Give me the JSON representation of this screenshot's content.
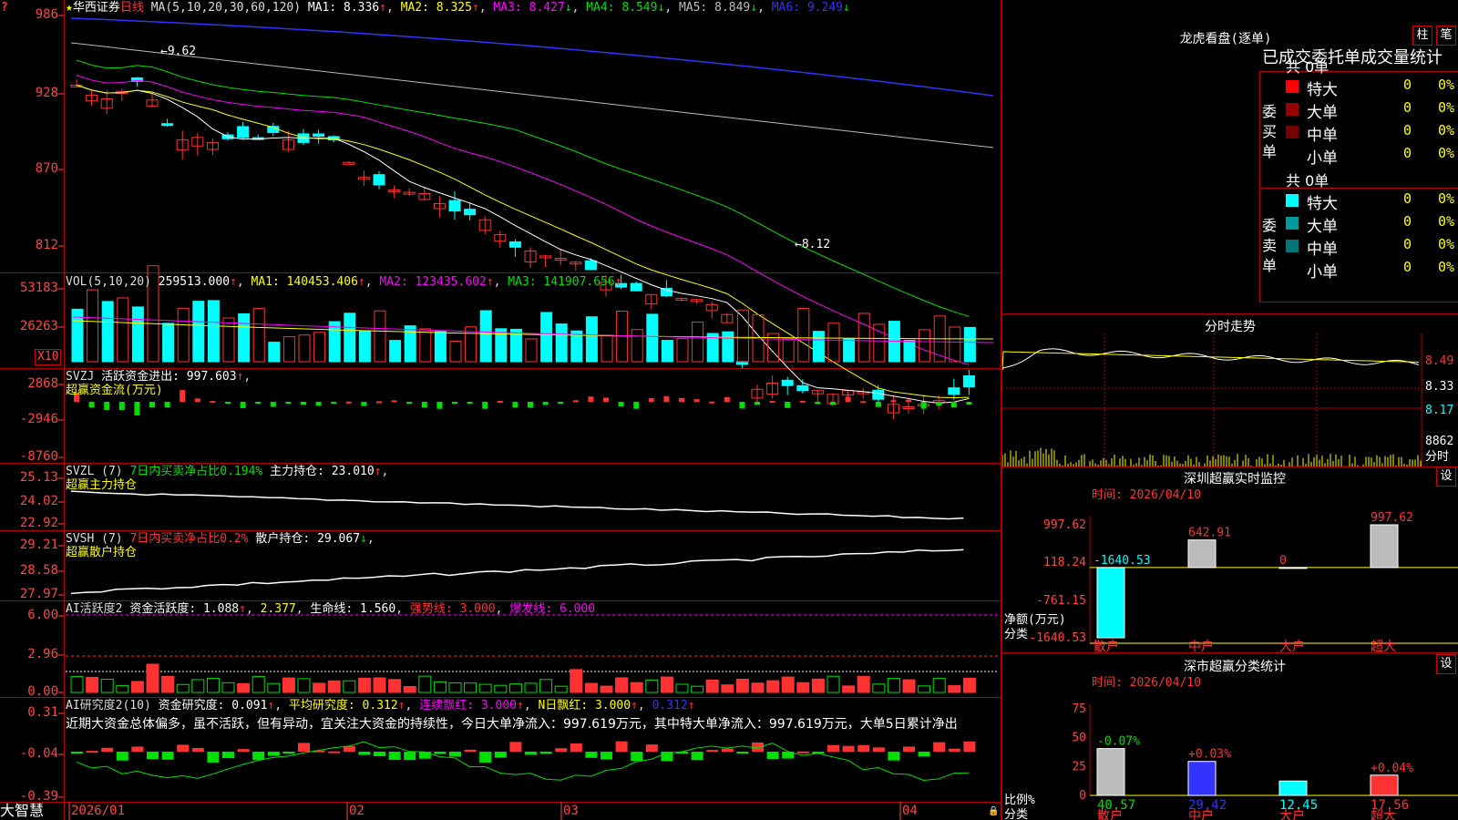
{
  "colors": {
    "up": "#ff3232",
    "down": "#00ffff",
    "green": "#00e000",
    "frame": "#b00000",
    "axis": "#ff4444",
    "white": "#ffffff",
    "yellow": "#ffff00",
    "magenta": "#ff00ff",
    "blue": "#3333ff",
    "gray": "#bbbbbb"
  },
  "corner_glyph": "?",
  "kline": {
    "star": "★",
    "name": "华西证券",
    "period": "日线",
    "ma_set": "MA(5,10,20,30,60,120)",
    "ma": [
      {
        "label": "MA1: 8.336",
        "arrow": "↑",
        "color": "#ffffff"
      },
      {
        "label": "MA2: 8.325",
        "arrow": "↑",
        "color": "#ffff00"
      },
      {
        "label": "MA3: 8.427",
        "arrow": "↓",
        "color": "#ff00ff"
      },
      {
        "label": "MA4: 8.549",
        "arrow": "↓",
        "color": "#00e000"
      },
      {
        "label": "MA5: 8.849",
        "arrow": "↓",
        "color": "#bbbbbb"
      },
      {
        "label": "MA6: 9.249",
        "arrow": "↓",
        "color": "#3333ff"
      }
    ],
    "yticks": [
      "986",
      "928",
      "870",
      "812"
    ],
    "high_note": "9.62",
    "low_note": "8.12"
  },
  "vol": {
    "title": "VOL(5,10,20)",
    "value": "259513.000",
    "ma1": "MA1: 140453.406",
    "ma2": "MA2: 123435.602",
    "ma3": "MA3: 141907.656",
    "yticks": [
      "53183",
      "26263"
    ],
    "unit": "X10"
  },
  "svzj": {
    "title": "SVZJ",
    "label": "活跃资金进出: 997.603",
    "sub": "超赢资金流(万元)",
    "yticks": [
      "2868",
      "-2946",
      "-8760"
    ]
  },
  "svzl": {
    "title": "SVZL (7)",
    "desc": "7日内买卖净占比0.194%",
    "label": "主力持仓: 23.010",
    "sub": "超赢主力持仓",
    "yticks": [
      "25.13",
      "24.02",
      "22.92"
    ]
  },
  "svsh": {
    "title": "SVSH (7)",
    "desc": "7日内买卖净占比0.2%",
    "label": "散户持仓: 29.067",
    "sub": "超赢散户持仓",
    "yticks": [
      "29.21",
      "28.58",
      "27.97"
    ]
  },
  "ai1": {
    "title": "AI活跃度2",
    "l1": "资金活跃度: 1.088",
    "l2": "2.377",
    "l3": "生命线: 1.560",
    "l4": "强势线: 3.000",
    "l5": "爆发线: 6.000",
    "yticks": [
      "6.00",
      "2.96",
      "0.00"
    ]
  },
  "ai2": {
    "title": "AI研究度2(10)",
    "l1": "资金研究度: 0.091",
    "l2": "平均研究度: 0.312",
    "l3": "连续飘红: 3.000",
    "l4": "N日飘红: 3.000",
    "l5": "0.312",
    "comment": "近期大资金总体偏多，虽不活跃，但有异动，宜关注大资金的持续性，今日大单净流入：997.619万元，其中特大单净流入：997.619万元，大单5日累计净出",
    "yticks": [
      "0.31",
      "-0.04",
      "-0.39"
    ]
  },
  "xaxis": {
    "labels": [
      "2026/01",
      "02",
      "03",
      "04"
    ]
  },
  "brand": "大智慧",
  "longhu": {
    "title": "龙虎看盘(逐单)",
    "btn1": "柱",
    "btn2": "笔",
    "header": "已成交委托单成交量统计",
    "buy": {
      "side": "委买单",
      "total": "共 0单",
      "rows": [
        {
          "name": "特大",
          "count": "0",
          "pct": "0%"
        },
        {
          "name": "大单",
          "count": "0",
          "pct": "0%"
        },
        {
          "name": "中单",
          "count": "0",
          "pct": "0%"
        },
        {
          "name": "小单",
          "count": "0",
          "pct": "0%"
        }
      ]
    },
    "sell": {
      "side": "委卖单",
      "total": "共 0单",
      "rows": [
        {
          "name": "特大",
          "count": "0",
          "pct": "0%"
        },
        {
          "name": "大单",
          "count": "0",
          "pct": "0%"
        },
        {
          "name": "中单",
          "count": "0",
          "pct": "0%"
        },
        {
          "name": "小单",
          "count": "0",
          "pct": "0%"
        }
      ]
    }
  },
  "intraday": {
    "title": "分时走势",
    "yticks": [
      "8.49",
      "8.33",
      "8.17"
    ],
    "vol_tick": "8862",
    "vol_label": "分时"
  },
  "monitor": {
    "title": "深圳超赢实时监控",
    "btn": "设",
    "time": "时间: 2026/04/10",
    "yticks": [
      "997.62",
      "118.24",
      "-761.15",
      "-1640.53"
    ],
    "ylabel": "净额(万元)",
    "xlabel": "分类",
    "categories": [
      "散户",
      "中户",
      "大户",
      "超大"
    ],
    "values": [
      -1640.53,
      642.91,
      0,
      997.62
    ],
    "value_labels": [
      "-1640.53",
      "642.91",
      "0",
      "997.62"
    ]
  },
  "classify": {
    "title": "深市超赢分类统计",
    "btn": "设",
    "time": "时间: 2026/04/10",
    "yticks": [
      "75",
      "50",
      "25",
      "0"
    ],
    "ylabel": "比例%",
    "xlabel": "分类",
    "categories": [
      "散户",
      "中户",
      "大户",
      "超大"
    ],
    "values": [
      40.57,
      29.42,
      12.45,
      17.56
    ],
    "changes": [
      "-0.07%",
      "+0.03%",
      "",
      "+0.04%"
    ]
  }
}
